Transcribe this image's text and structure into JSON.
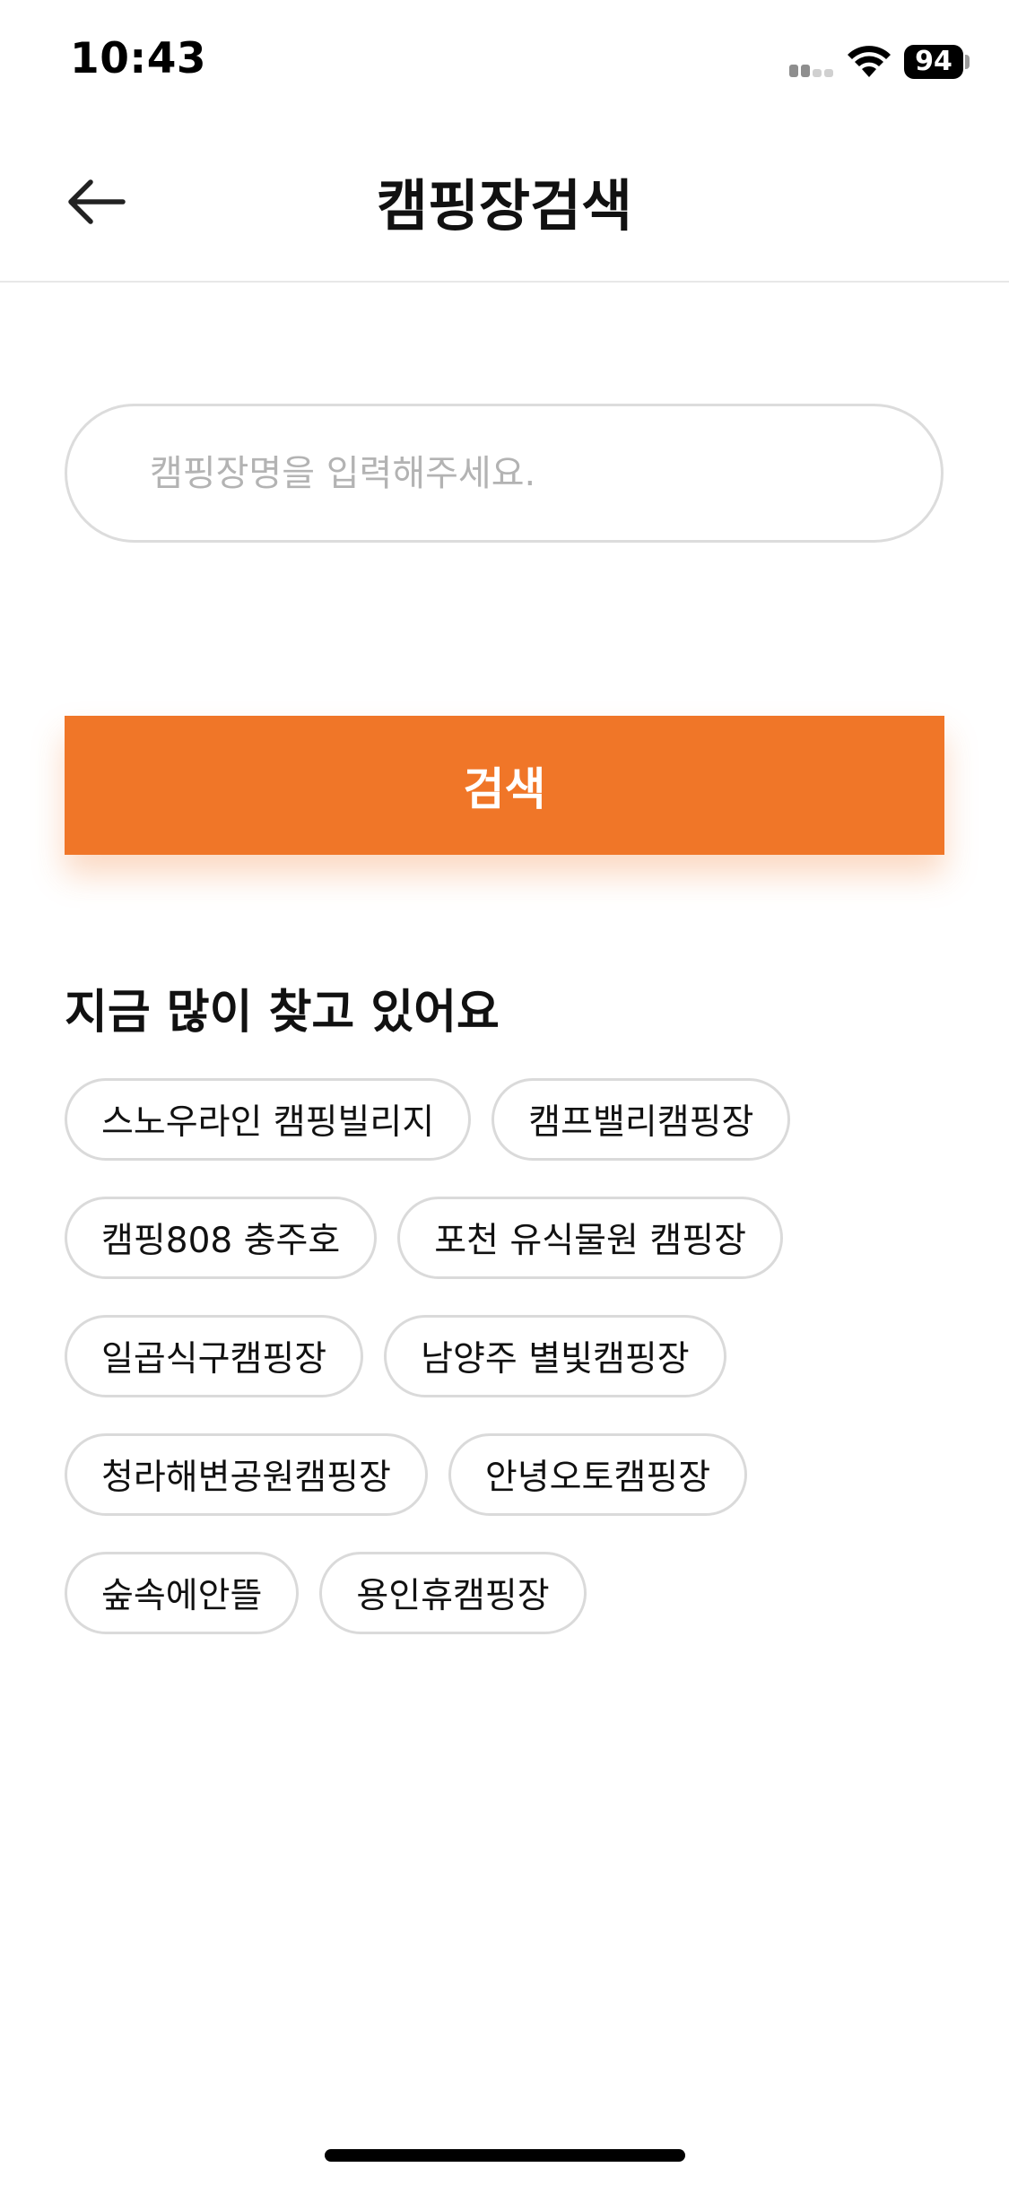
{
  "status_bar": {
    "time": "10:43",
    "battery": "94",
    "icons": [
      "signal-icon",
      "wifi-icon",
      "battery-icon"
    ]
  },
  "header": {
    "title": "캠핑장검색",
    "back_icon": "arrow-left-icon"
  },
  "search": {
    "placeholder": "캠핑장명을 입력해주세요.",
    "value": "",
    "button_label": "검색"
  },
  "popular": {
    "title": "지금 많이 찾고 있어요",
    "tags": [
      "스노우라인 캠핑빌리지",
      "캠프밸리캠핑장",
      "캠핑808 충주호",
      "포천 유식물원 캠핑장",
      "일곱식구캠핑장",
      "남양주 별빛캠핑장",
      "청라해변공원캠핑장",
      "안녕오토캠핑장",
      "숲속에안뜰",
      "용인휴캠핑장"
    ]
  },
  "colors": {
    "accent": "#f07628",
    "border": "#dadada",
    "text": "#111111",
    "placeholder": "#b3b3b3"
  }
}
